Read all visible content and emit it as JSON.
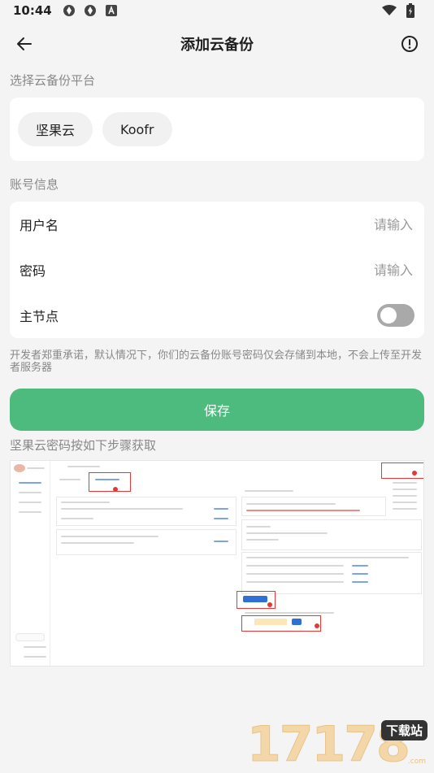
{
  "status_bar": {
    "time": "10:44"
  },
  "app_bar": {
    "title": "添加云备份"
  },
  "platform_section": {
    "label": "选择云备份平台",
    "options": [
      "坚果云",
      "Koofr"
    ]
  },
  "account_section": {
    "label": "账号信息",
    "username_label": "用户名",
    "username_placeholder": "请输入",
    "password_label": "密码",
    "password_placeholder": "请输入",
    "main_node_label": "主节点",
    "main_node_enabled": false
  },
  "note": "开发者郑重承诺，默认情况下，你们的云备份账号密码仅会存储到本地，不会上传至开发者服务器",
  "save_button": "保存",
  "guide_title": "坚果云密码按如下步骤获取",
  "watermark": {
    "digits": "17178",
    "badge": "下载站",
    "sub": ".com"
  },
  "colors": {
    "accent": "#4dbb7e",
    "toggle_off": "#a9a9a9"
  }
}
